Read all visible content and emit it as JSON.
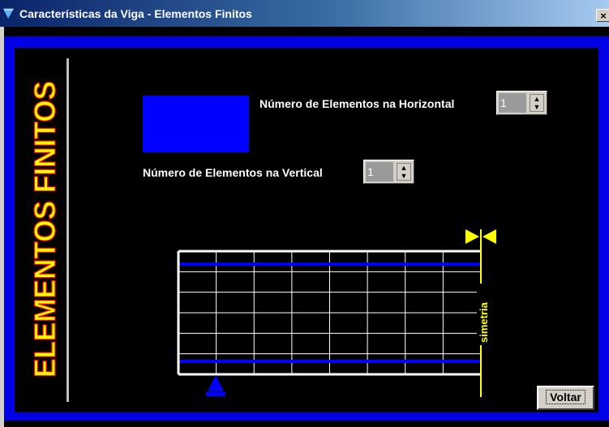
{
  "window": {
    "title": "Características da Viga - Elementos Finitos",
    "close_symbol": "×"
  },
  "sidebar": {
    "title": "ELEMENTOS FINITOS",
    "title_fill": "#ffff00",
    "title_stroke": "#ff0000"
  },
  "form": {
    "horizontal_label": "Número de Elementos na Horizontal",
    "horizontal_value": "1",
    "vertical_label": "Número de Elementos na Vertical",
    "vertical_value": "1"
  },
  "diagram": {
    "symmetry_label": "simetria",
    "columns": 8,
    "rows": 6
  },
  "buttons": {
    "back_label": "Voltar"
  },
  "colors": {
    "frame_blue": "#0000e6",
    "background": "#000000",
    "grid_white": "#ffffff",
    "highlight_blue": "#0000ff",
    "symmetry_yellow": "#ffff00",
    "support_blue": "#0000ff"
  }
}
